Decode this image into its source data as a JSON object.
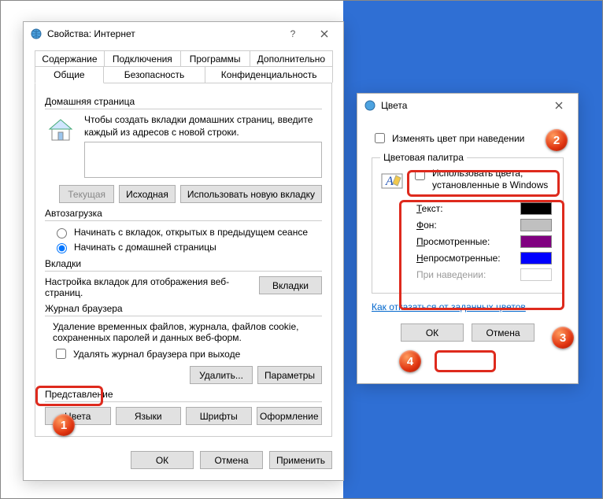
{
  "main": {
    "title": "Свойства: Интернет",
    "tabs_row1": [
      "Содержание",
      "Подключения",
      "Программы",
      "Дополнительно"
    ],
    "tabs_row2": [
      "Общие",
      "Безопасность",
      "Конфиденциальность"
    ],
    "active_tab": "Общие",
    "home": {
      "legend": "Домашняя страница",
      "hint": "Чтобы создать вкладки домашних страниц, введите каждый из адресов с новой строки.",
      "value": "",
      "btn_current": "Текущая",
      "btn_default": "Исходная",
      "btn_newtab": "Использовать новую вкладку"
    },
    "startup": {
      "legend": "Автозагрузка",
      "opt_last": "Начинать с вкладок, открытых в предыдущем сеансе",
      "opt_home": "Начинать с домашней страницы",
      "selected": "home"
    },
    "tabs_section": {
      "legend": "Вкладки",
      "desc": "Настройка вкладок для отображения веб-страниц.",
      "btn": "Вкладки"
    },
    "history": {
      "legend": "Журнал браузера",
      "desc": "Удаление временных файлов, журнала, файлов cookie, сохраненных паролей и данных веб-форм.",
      "check": "Удалять журнал браузера при выходе",
      "checked": false,
      "btn_delete": "Удалить...",
      "btn_params": "Параметры"
    },
    "appearance": {
      "legend": "Представление",
      "btn_colors": "Цвета",
      "btn_langs": "Языки",
      "btn_fonts": "Шрифты",
      "btn_access": "Оформление"
    },
    "footer": {
      "ok": "ОК",
      "cancel": "Отмена",
      "apply": "Применить"
    }
  },
  "colors": {
    "title": "Цвета",
    "hover_check": "Изменять цвет при наведении",
    "hover_checked": false,
    "palette_legend": "Цветовая палитра",
    "use_win": "Использовать цвета, установленные в Windows",
    "use_win_checked": false,
    "rows": {
      "text": {
        "label": "Текст:",
        "color": "#000000"
      },
      "bg": {
        "label": "Фон:",
        "color": "#c0c0c0"
      },
      "visited": {
        "label": "Просмотренные:",
        "color": "#800080"
      },
      "unvisited": {
        "label": "Непросмотренные:",
        "color": "#0000ff"
      },
      "hover": {
        "label": "При наведении:",
        "color": "#ffffff",
        "disabled": true
      }
    },
    "link": "Как отказаться от заданных цветов",
    "ok": "ОК",
    "cancel": "Отмена"
  },
  "badges": {
    "b1": "1",
    "b2": "2",
    "b3": "3",
    "b4": "4"
  }
}
